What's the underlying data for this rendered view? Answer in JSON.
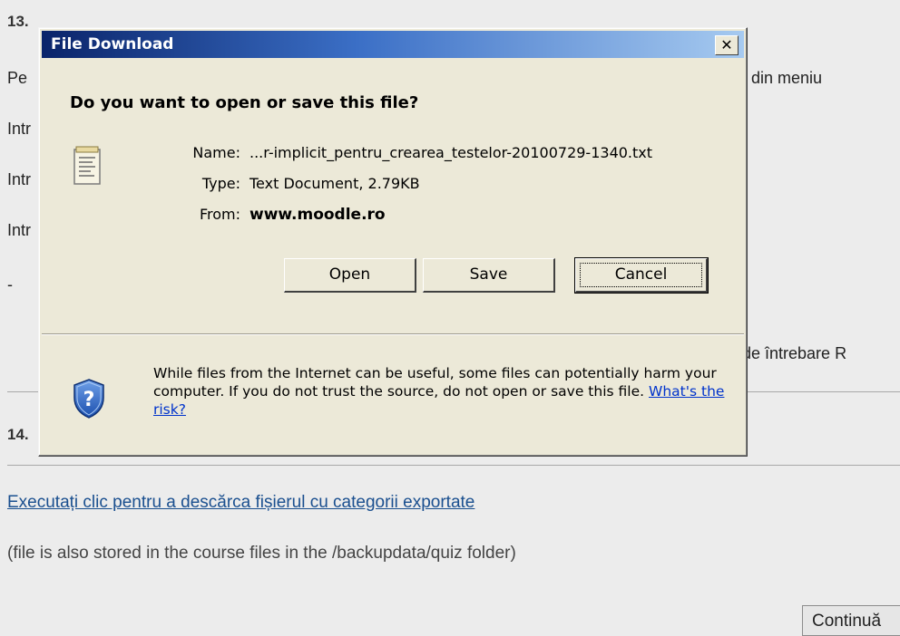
{
  "page": {
    "step13_label": "13.",
    "line_pe": "Pe",
    "line_pe_right": "din meniu",
    "line_int1": "Intr",
    "line_int2": "Intr",
    "line_int3": "Intr",
    "dash": "-",
    "line_intrebare": "de întrebare R",
    "step14_label": "14.",
    "download_link": "Executați clic pentru a descărca fișierul cu categorii exportate",
    "note": "(file is also stored in the course files in the /backupdata/quiz folder)",
    "continue_label": "Continuă"
  },
  "dialog": {
    "title": "File Download",
    "close_symbol": "✕",
    "question": "Do you want to open or save this file?",
    "name_label": "Name:",
    "name_value": "...r-implicit_pentru_crearea_testelor-20100729-1340.txt",
    "type_label": "Type:",
    "type_value": "Text Document, 2.79KB",
    "from_label": "From:",
    "from_value": "www.moodle.ro",
    "open_label": "Open",
    "save_label": "Save",
    "cancel_label": "Cancel",
    "warning_text": "While files from the Internet can be useful, some files can potentially harm your computer. If you do not trust the source, do not open or save this file.",
    "risk_link": "What's the risk?",
    "file_icon": "text-file-icon",
    "shield_icon": "security-shield-icon"
  }
}
